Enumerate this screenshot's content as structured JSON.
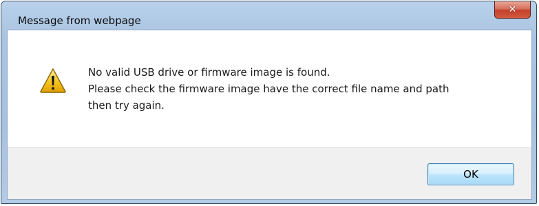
{
  "window": {
    "title": "Message from webpage"
  },
  "message": {
    "lines": [
      "No valid USB drive or firmware image is found.",
      "Please check the firmware image have the correct file name and path",
      "then try again."
    ]
  },
  "buttons": {
    "ok_label": "OK"
  },
  "icons": {
    "alert": "warning-icon",
    "close": "close-icon"
  },
  "colors": {
    "close_button": "#c4402a",
    "warning_yellow": "#f7c925",
    "ok_button_border": "#3c7fb1"
  }
}
